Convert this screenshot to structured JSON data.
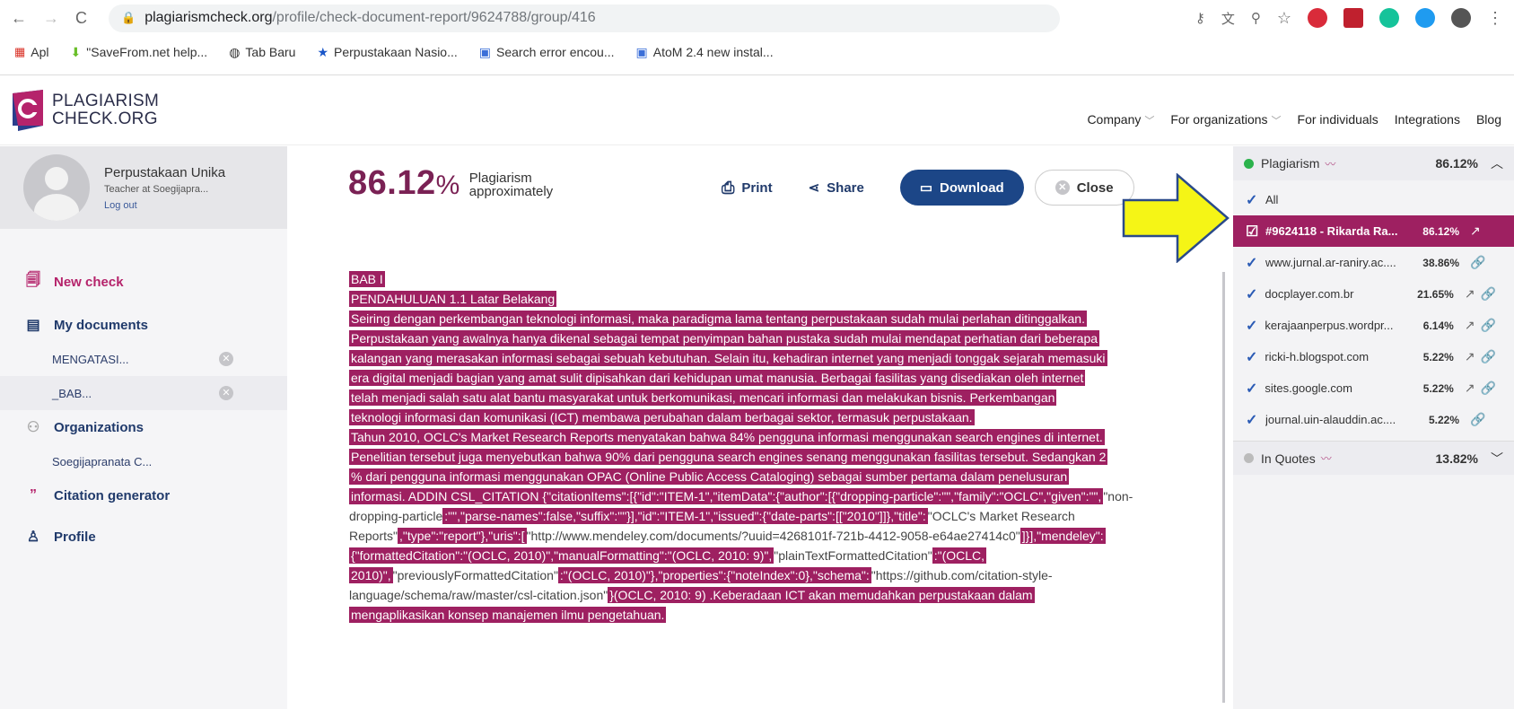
{
  "browser": {
    "url_host": "plagiarismcheck.org",
    "url_path": "/profile/check-document-report/9624788/group/416",
    "bookmarks": [
      "Apl",
      "\"SaveFrom.net help...",
      "Tab Baru",
      "Perpustakaan Nasio...",
      "Search error encou...",
      "AtoM 2.4 new instal..."
    ]
  },
  "site": {
    "logo_line1": "PLAGIARISM",
    "logo_line2": "CHECK.ORG",
    "nav": [
      "Company",
      "For organizations",
      "For individuals",
      "Integrations",
      "Blog"
    ]
  },
  "user": {
    "name": "Perpustakaan Unika",
    "role": "Teacher at Soegijapra...",
    "logout": "Log out"
  },
  "menu": {
    "new_check": "New check",
    "my_documents": "My documents",
    "doc1": "MENGATASI...",
    "doc2": "_BAB...",
    "organizations": "Organizations",
    "org1": "Soegijapranata C...",
    "citation": "Citation generator",
    "profile": "Profile"
  },
  "result": {
    "percent": "86.12",
    "label1": "Plagiarism",
    "label2": "approximately",
    "print": "Print",
    "share": "Share",
    "download": "Download",
    "close": "Close"
  },
  "doc": {
    "l1": "BAB I",
    "l2": "PENDAHULUAN 1.1 Latar Belakang",
    "l3": "Seiring dengan perkembangan teknologi informasi, maka paradigma lama tentang perpustakaan sudah mulai perlahan ditinggalkan.",
    "l4": "Perpustakaan yang awalnya hanya dikenal sebagai tempat penyimpan bahan pustaka sudah mulai mendapat perhatian dari beberapa",
    "l5": "kalangan yang merasakan informasi sebagai sebuah kebutuhan. Selain itu, kehadiran internet yang menjadi tonggak sejarah memasuki",
    "l6": "era digital menjadi bagian yang amat sulit dipisahkan dari kehidupan umat manusia. Berbagai fasilitas yang disediakan oleh internet",
    "l7": "telah menjadi salah satu alat bantu masyarakat untuk berkomunikasi, mencari informasi dan melakukan bisnis. Perkembangan",
    "l8": "teknologi informasi dan komunikasi  (ICT) membawa perubahan dalam berbagai sektor, termasuk perpustakaan.",
    "l9": "Tahun 2010, OCLC's Market Research Reports menyatakan bahwa 84% pengguna informasi menggunakan search engines di internet.",
    "l10": "Penelitian tersebut juga menyebutkan bahwa 90% dari pengguna search engines senang menggunakan fasilitas tersebut. Sedangkan 2",
    "l11": "% dari pengguna informasi menggunakan OPAC (Online Public Access Cataloging)  sebagai sumber pertama dalam penelusuran",
    "l12a": "informasi. ADDIN CSL_CITATION {\"citationItems\":[{\"id\":\"ITEM-1\",\"itemData\":{\"author\":[{\"dropping-particle\":\"\",\"family\":\"OCLC\",\"given\":\"\",",
    "l12b": "\"non-",
    "l13a": "dropping-particle",
    "l13b": ":\"\",\"parse-names\":false,\"suffix\":\"\"}],\"id\":\"ITEM-1\",\"issued\":{\"date-parts\":[[\"2010\"]]},\"title\":",
    "l13c": "\"OCLC's Market Research",
    "l14a": "Reports\"",
    "l14b": ",\"type\":\"report\"},\"uris\":[",
    "l14c": "\"http://www.mendeley.com/documents/?uuid=4268101f-721b-4412-9058-e64ae27414c0\"",
    "l14d": "]}],\"mendeley\":",
    "l15a": "{\"formattedCitation\":\"(OCLC, 2010)\",\"manualFormatting\":\"(OCLC, 2010: 9)\",",
    "l15b": "\"plainTextFormattedCitation\"",
    "l15c": ":\"(OCLC,",
    "l16a": "2010)\",",
    "l16b": "\"previouslyFormattedCitation\"",
    "l16c": ":\"(OCLC, 2010)\"},\"properties\":{\"noteIndex\":0},\"schema\":",
    "l16d": "\"https://github.com/citation-style-",
    "l17a": "language/schema/raw/master/csl-citation.json\"",
    "l17b": "}(OCLC, 2010: 9) .Keberadaan ICT akan memudahkan perpustakaan dalam",
    "l18": "mengaplikasikan konsep manajemen ilmu pengetahuan."
  },
  "panel": {
    "plag_label": "Plagiarism",
    "plag_pct": "86.12%",
    "all": "All",
    "sources": [
      {
        "name": "#9624118 - Rikarda Ra...",
        "pct": "86.12%",
        "icons": "↗"
      },
      {
        "name": "www.jurnal.ar-raniry.ac....",
        "pct": "38.86%",
        "icons": "🔗"
      },
      {
        "name": "docplayer.com.br",
        "pct": "21.65%",
        "icons": "↗🔗"
      },
      {
        "name": "kerajaanperpus.wordpr...",
        "pct": "6.14%",
        "icons": "↗🔗"
      },
      {
        "name": "ricki-h.blogspot.com",
        "pct": "5.22%",
        "icons": "↗🔗"
      },
      {
        "name": "sites.google.com",
        "pct": "5.22%",
        "icons": "↗🔗"
      },
      {
        "name": "journal.uin-alauddin.ac....",
        "pct": "5.22%",
        "icons": "🔗"
      }
    ],
    "quotes_label": "In Quotes",
    "quotes_pct": "13.82%"
  },
  "colors": {
    "accent": "#9e2061",
    "brand_blue": "#1c4687",
    "arrow": "#f5f516"
  }
}
